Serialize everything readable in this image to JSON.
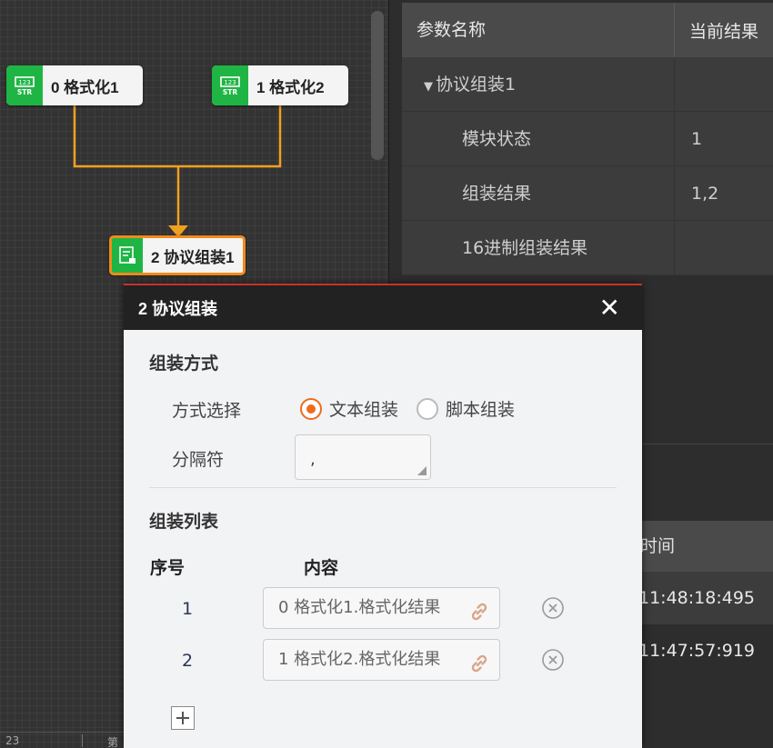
{
  "flow": {
    "nodes": [
      {
        "label": "0 格式化1",
        "icon": "format-str-icon"
      },
      {
        "label": "1 格式化2",
        "icon": "format-str-icon"
      },
      {
        "label": "2 协议组装1",
        "icon": "protocol-assemble-icon"
      }
    ],
    "connector_color": "#f0a020",
    "selected_border_color": "#f08a1c",
    "node_icon_color": "#1fb544"
  },
  "status_bar": {
    "left_text": "23",
    "right_text": "第"
  },
  "param_table": {
    "headers": [
      "参数名称",
      "当前结果"
    ],
    "rows": [
      {
        "name": "协议组装1",
        "value": "",
        "type": "group"
      },
      {
        "name": "模块状态",
        "value": "1",
        "type": "child"
      },
      {
        "name": "组装结果",
        "value": "1,2",
        "type": "child"
      },
      {
        "name": "16进制组装结果",
        "value": "",
        "type": "child"
      }
    ]
  },
  "log_table": {
    "header": "时间",
    "rows": [
      "11:48:18:495",
      "11:47:57:919"
    ]
  },
  "dialog": {
    "title": "2 协议组装",
    "close_icon": "close-icon",
    "accent_color": "#f06a1c",
    "section_method": "组装方式",
    "method_label": "方式选择",
    "options": [
      "文本组装",
      "脚本组装"
    ],
    "selected_option": "文本组装",
    "separator_label": "分隔符",
    "separator_value": ",",
    "section_list": "组装列表",
    "col_index": "序号",
    "col_content": "内容",
    "items": [
      {
        "index": "1",
        "content": "0 格式化1.格式化结果"
      },
      {
        "index": "2",
        "content": "1 格式化2.格式化结果"
      }
    ]
  }
}
